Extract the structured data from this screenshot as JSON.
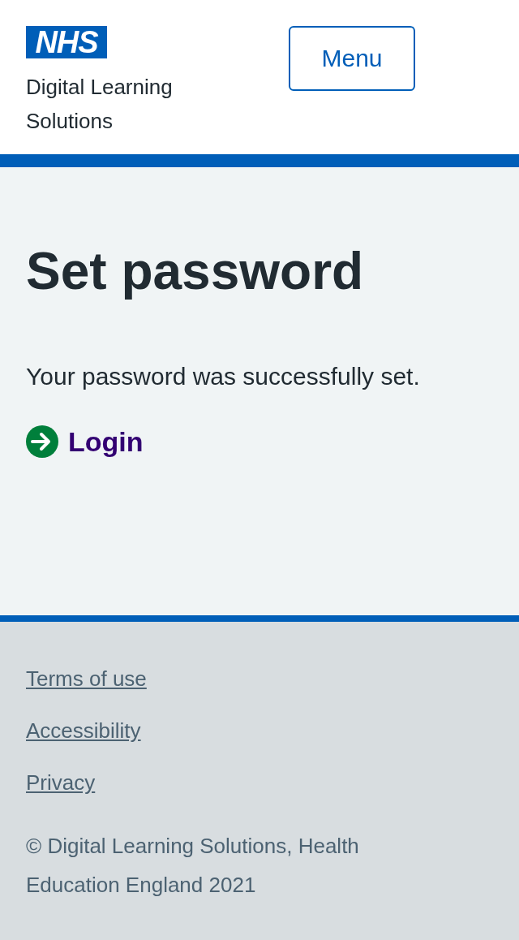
{
  "header": {
    "logo": "NHS",
    "service_name": "Digital Learning Solutions",
    "menu_button": "Menu"
  },
  "main": {
    "title": "Set password",
    "message": "Your password was successfully set.",
    "action_link": "Login"
  },
  "footer": {
    "links": [
      "Terms of use",
      "Accessibility",
      "Privacy"
    ],
    "copyright": "© Digital Learning Solutions, Health Education England 2021"
  }
}
